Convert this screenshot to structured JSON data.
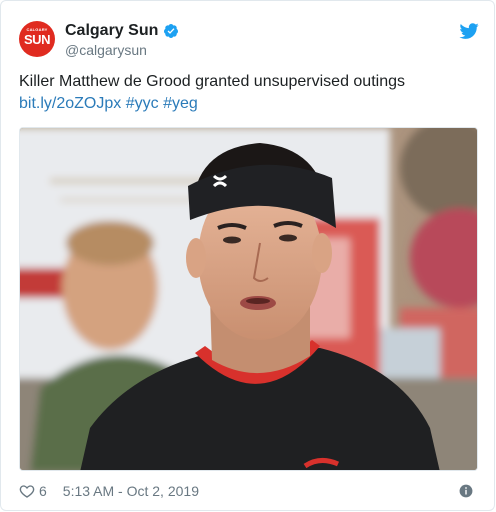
{
  "account": {
    "display_name": "Calgary Sun",
    "handle": "@calgarysun",
    "avatar_text": "SUN",
    "avatar_top_text": "CALGARY"
  },
  "tweet": {
    "text": "Killer Matthew de Grood granted unsupervised outings",
    "link": "bit.ly/2oZOJpx",
    "hashtags": [
      "#yyc",
      "#yeg"
    ]
  },
  "media": {
    "icons": [
      "under-armour-logo"
    ]
  },
  "footer": {
    "like_count": "6",
    "timestamp": "5:13 AM - Oct 2, 2019"
  },
  "colors": {
    "link": "#2b7bb9",
    "brand_red": "#e02b20",
    "twitter_blue": "#1da1f2",
    "secondary_text": "#697882"
  },
  "icons": [
    "verified-badge-icon",
    "twitter-bird-icon",
    "heart-icon",
    "info-icon"
  ]
}
